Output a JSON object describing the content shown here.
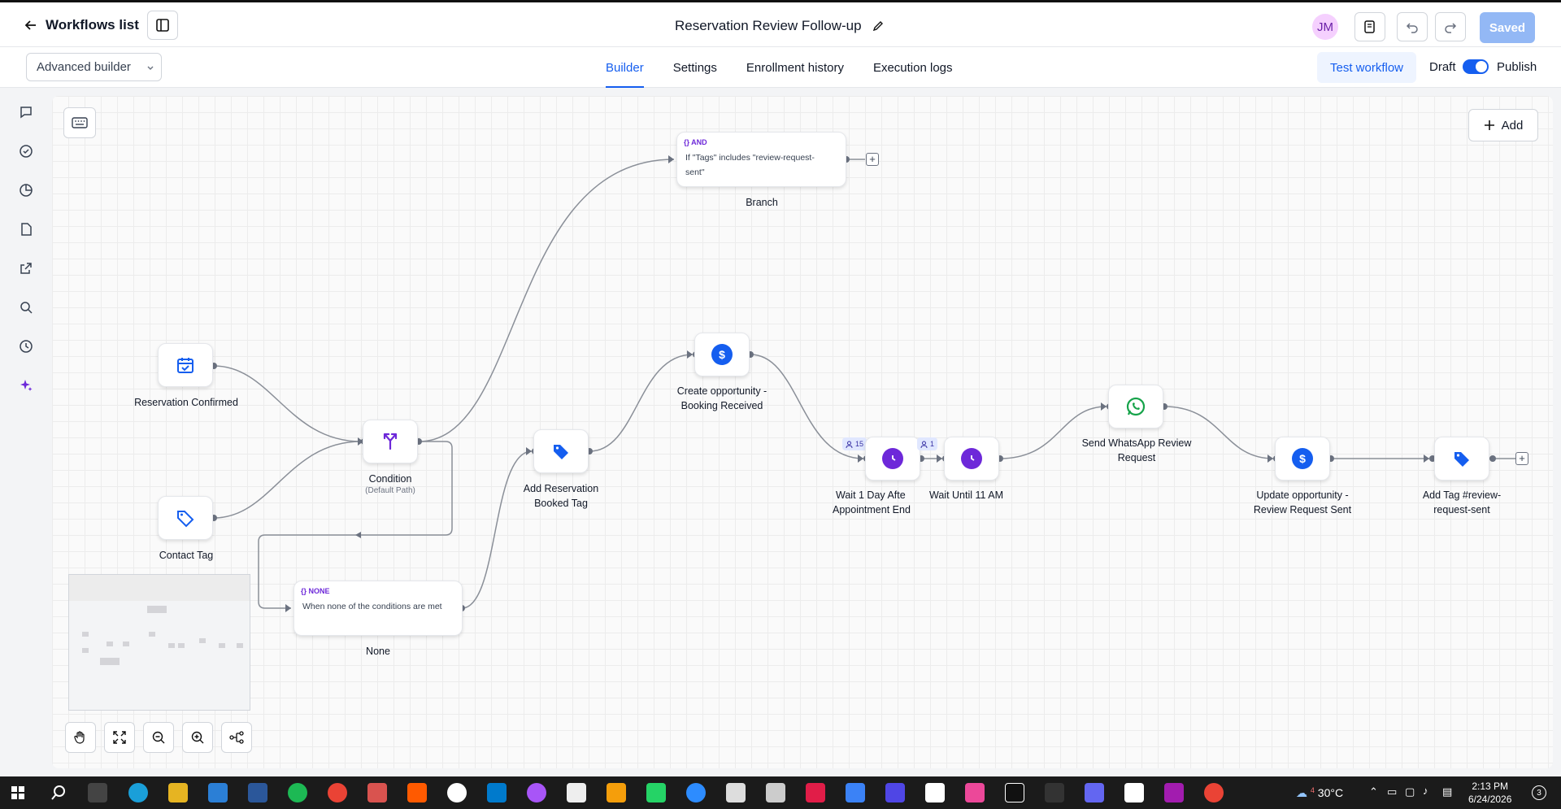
{
  "header": {
    "back_label": "Workflows list",
    "title": "Reservation Review Follow-up",
    "avatar_initials": "JM",
    "saved_label": "Saved"
  },
  "subbar": {
    "mode": "Advanced builder",
    "tabs": [
      {
        "label": "Builder",
        "active": true
      },
      {
        "label": "Settings",
        "active": false
      },
      {
        "label": "Enrollment history",
        "active": false
      },
      {
        "label": "Execution logs",
        "active": false
      }
    ],
    "test_label": "Test workflow",
    "draft_label": "Draft",
    "publish_label": "Publish"
  },
  "canvas": {
    "add_label": "Add",
    "nodes": {
      "reservation_confirmed": "Reservation Confirmed",
      "contact_tag": "Contact Tag",
      "condition": "Condition",
      "condition_sub": "(Default Path)",
      "branch_tag": "AND",
      "branch_body_1": "If \"Tags\" includes \"review-request-",
      "branch_body_2": "sent\"",
      "branch_label": "Branch",
      "none_tag": "NONE",
      "none_body": "When none of the conditions are met",
      "none_label": "None",
      "add_reservation_1": "Add Reservation",
      "add_reservation_2": "Booked Tag",
      "create_opp_1": "Create opportunity -",
      "create_opp_2": "Booking Received",
      "wait1_1": "Wait 1 Day Afte",
      "wait1_2": "Appointment End",
      "wait1_badge": "15",
      "wait2": "Wait Until 11 AM",
      "wait2_badge": "1",
      "whatsapp_1": "Send WhatsApp Review",
      "whatsapp_2": "Request",
      "update_opp_1": "Update opportunity -",
      "update_opp_2": "Review Request Sent",
      "add_tag_1": "Add Tag #review-",
      "add_tag_2": "request-sent"
    }
  },
  "taskbar": {
    "temperature": "30°C",
    "time": "2:13 PM",
    "date": "6/24/2026",
    "weather_badge": "4",
    "notif_count": "3"
  },
  "colors": {
    "accent": "#155eef",
    "purple": "#6d28d9",
    "whatsapp": "#25d366"
  }
}
